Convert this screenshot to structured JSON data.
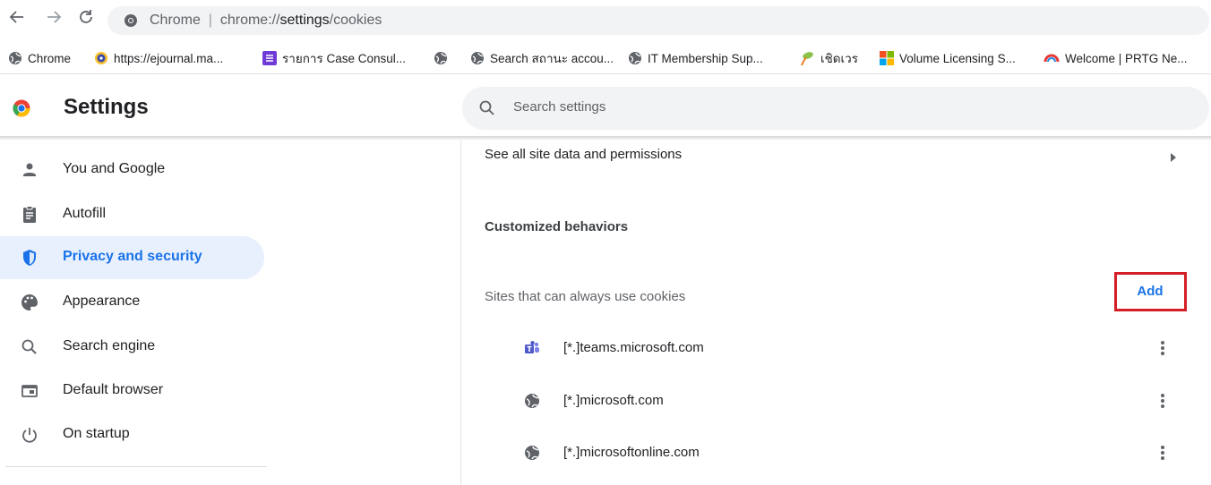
{
  "browser": {
    "back_icon": "back-arrow-icon",
    "forward_icon": "forward-arrow-icon",
    "reload_icon": "reload-icon",
    "omnibox": {
      "site_label": "Chrome",
      "separator": "|",
      "url_scheme": "chrome://",
      "url_host": "settings",
      "url_path": "/cookies"
    }
  },
  "bookmarks": [
    {
      "label": "Chrome",
      "icon": "globe-icon"
    },
    {
      "label": "https://ejournal.ma...",
      "icon": "ejournal-icon"
    },
    {
      "label": "รายการ Case Consul...",
      "icon": "list-icon"
    },
    {
      "label": "",
      "icon": "globe-icon"
    },
    {
      "label": "Search สถานะ accou...",
      "icon": "globe-icon"
    },
    {
      "label": "IT Membership Sup...",
      "icon": "globe-icon"
    },
    {
      "label": "เชิดเวร",
      "icon": "leaf-icon"
    },
    {
      "label": "Volume Licensing S...",
      "icon": "microsoft-logo-icon"
    },
    {
      "label": "Welcome | PRTG Ne...",
      "icon": "prtg-icon"
    }
  ],
  "settings": {
    "title": "Settings",
    "search_placeholder": "Search settings"
  },
  "sidebar": {
    "items": [
      {
        "label": "You and Google",
        "icon": "person-icon",
        "active": false
      },
      {
        "label": "Autofill",
        "icon": "clipboard-icon",
        "active": false
      },
      {
        "label": "Privacy and security",
        "icon": "shield-icon",
        "active": true
      },
      {
        "label": "Appearance",
        "icon": "palette-icon",
        "active": false
      },
      {
        "label": "Search engine",
        "icon": "search-icon",
        "active": false
      },
      {
        "label": "Default browser",
        "icon": "browser-window-icon",
        "active": false
      },
      {
        "label": "On startup",
        "icon": "power-icon",
        "active": false
      }
    ]
  },
  "content": {
    "see_all_label": "See all site data and permissions",
    "customized_heading": "Customized behaviors",
    "always_allow_label": "Sites that can always use cookies",
    "add_label": "Add",
    "sites": [
      {
        "label": "[*.]teams.microsoft.com",
        "icon": "teams-icon"
      },
      {
        "label": "[*.]microsoft.com",
        "icon": "globe-icon"
      },
      {
        "label": "[*.]microsoftonline.com",
        "icon": "globe-icon"
      }
    ]
  },
  "colors": {
    "accent": "#1a73e8",
    "active_bg": "#e8f0fe",
    "highlight_box": "#d41f26"
  }
}
